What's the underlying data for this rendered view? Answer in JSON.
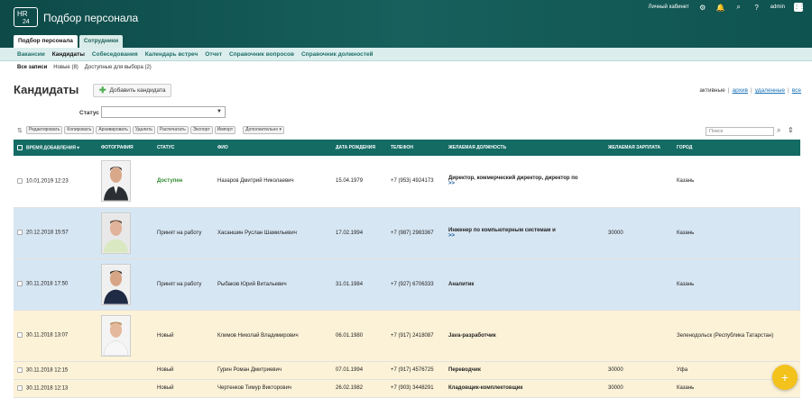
{
  "app": {
    "logo_top": "HR",
    "logo_bottom": "24",
    "title": "Подбор персонала"
  },
  "top_right": {
    "cabinet": "Личный кабинет",
    "user": "admin"
  },
  "tabs": [
    {
      "label": "Подбор персонала",
      "active": true
    },
    {
      "label": "Сотрудники",
      "active": false
    }
  ],
  "subnav": [
    "Вакансии",
    "Кандидаты",
    "Собеседования",
    "Календарь встреч",
    "Отчет",
    "Справочник вопросов",
    "Справочник должностей"
  ],
  "subnav_selected": "Кандидаты",
  "filters": [
    "Все записи",
    "Новые (8)",
    "Доступные для выбора (2)"
  ],
  "page_title": "Кандидаты",
  "add_button": "Добавить кандидата",
  "views": [
    "активные",
    "архив",
    "удаленные",
    "все"
  ],
  "status_label": "Статус :",
  "toolbar": [
    "Редактировать",
    "Копировать",
    "Архивировать",
    "Удалить",
    "Распечатать",
    "Экспорт",
    "Импорт"
  ],
  "toolbar_more": "Дополнительно",
  "search_placeholder": "Поиск",
  "columns": [
    "ВРЕМЯ ДОБАВЛЕНИЯ",
    "ФОТОГРАФИЯ",
    "СТАТУС",
    "ФИО",
    "ДАТА РОЖДЕНИЯ",
    "ТЕЛЕФОН",
    "ЖЕЛАЕМАЯ ДОЛЖНОСТЬ",
    "ЖЕЛАЕМАЯ ЗАРПЛАТА",
    "ГОРОД"
  ],
  "rows": [
    {
      "added": "10.01.2019 12:23",
      "photo": true,
      "status": "Доступен",
      "fio": "Назаров Дмитрий Николаевич",
      "birth": "15.04.1979",
      "phone": "+7 (953) 4924173",
      "position": "Директор, коммерческий директор, директор по",
      "more": ">>",
      "salary": "",
      "city": "Казань",
      "color": "white"
    },
    {
      "added": "20.12.2018 15:57",
      "photo": true,
      "status": "Принят на работу",
      "fio": "Хасаншин Руслан Шамильевич",
      "birth": "17.02.1994",
      "phone": "+7 (987) 2983367",
      "position": "Инженер по компьютерным системам и",
      "more": ">>",
      "salary": "30000",
      "city": "Казань",
      "color": "blue"
    },
    {
      "added": "30.11.2018 17:50",
      "photo": true,
      "status": "Принят на работу",
      "fio": "Рыбаков Юрий Витальевич",
      "birth": "31.01.1984",
      "phone": "+7 (927) 6706333",
      "position": "Аналитик",
      "more": "",
      "salary": "",
      "city": "Казань",
      "color": "blue"
    },
    {
      "added": "30.11.2018 13:07",
      "photo": true,
      "status": "Новый",
      "fio": "Климов Николай Владимирович",
      "birth": "06.01.1980",
      "phone": "+7 (917) 2418087",
      "position": "Java-разработчик",
      "more": "",
      "salary": "",
      "city": "Зеленодольск (Республика Татарстан)",
      "color": "yellow"
    },
    {
      "added": "30.11.2018 12:15",
      "photo": false,
      "status": "Новый",
      "fio": "Гурин Роман Дмитриевич",
      "birth": "07.01.1994",
      "phone": "+7 (917) 4576725",
      "position": "Переводчик",
      "more": "",
      "salary": "30000",
      "city": "Уфа",
      "color": "yellow"
    },
    {
      "added": "30.11.2018 12:13",
      "photo": false,
      "status": "Новый",
      "fio": "Чертенков Тимур Викторович",
      "birth": "26.02.1982",
      "phone": "+7 (903) 3448291",
      "position": "Кладовщик-комплектовщик",
      "more": "",
      "salary": "30000",
      "city": "Казань",
      "color": "yellow"
    }
  ],
  "fab": "+"
}
